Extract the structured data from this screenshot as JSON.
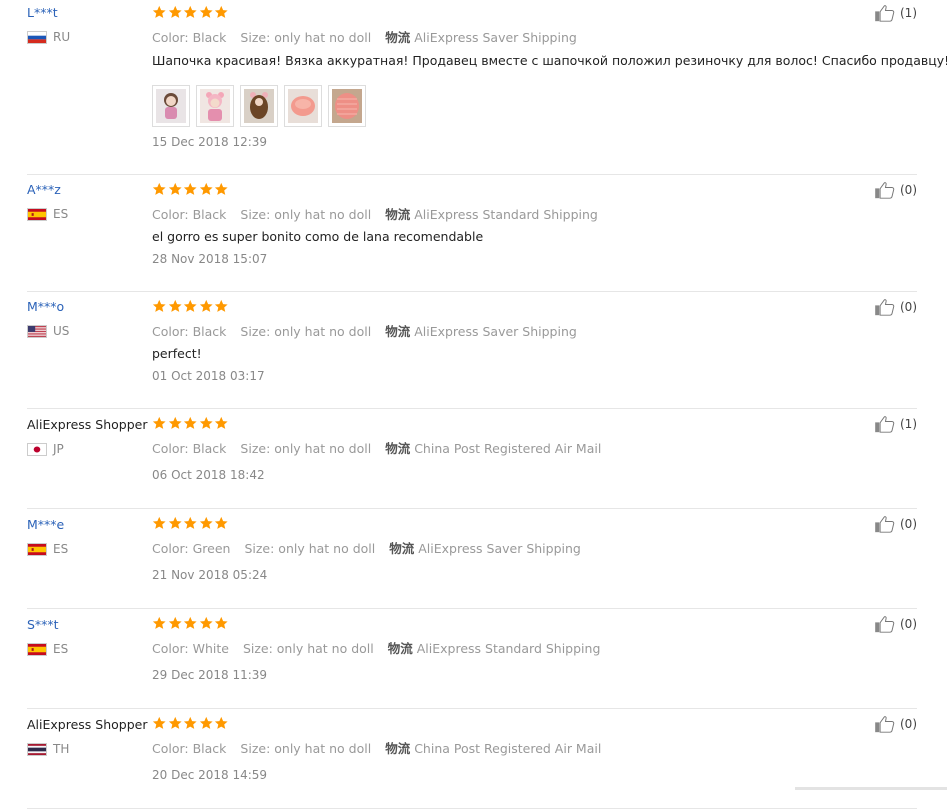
{
  "reviews": [
    {
      "user": "L***t",
      "country": "RU",
      "flag": "ru",
      "rating": 5,
      "color": "Color: Black",
      "size": "Size: only hat no doll",
      "ship_label": "物流",
      "shipping": "AliExpress Saver Shipping",
      "text": "Шапочка красивая! Вязка аккуратная! Продавец вместе с шапочкой положил резиночку для волос! Спасибо продавцу!",
      "photos": 5,
      "date": "15 Dec 2018 12:39",
      "useful": "(1)"
    },
    {
      "user": "A***z",
      "country": "ES",
      "flag": "es",
      "rating": 5,
      "color": "Color: Black",
      "size": "Size: only hat no doll",
      "ship_label": "物流",
      "shipping": "AliExpress Standard Shipping",
      "text": "el gorro es super bonito como de lana recomendable",
      "date": "28 Nov 2018 15:07",
      "useful": "(0)"
    },
    {
      "user": "M***o",
      "country": "US",
      "flag": "us",
      "rating": 5,
      "color": "Color: Black",
      "size": "Size: only hat no doll",
      "ship_label": "物流",
      "shipping": "AliExpress Saver Shipping",
      "text": "perfect!",
      "date": "01 Oct 2018 03:17",
      "useful": "(0)"
    },
    {
      "user": "AliExpress Shopper",
      "country": "JP",
      "flag": "jp",
      "rating": 5,
      "color": "Color: Black",
      "size": "Size: only hat no doll",
      "ship_label": "物流",
      "shipping": "China Post Registered Air Mail",
      "date": "06 Oct 2018 18:42",
      "useful": "(1)"
    },
    {
      "user": "M***e",
      "country": "ES",
      "flag": "es",
      "rating": 5,
      "color": "Color: Green",
      "size": "Size: only hat no doll",
      "ship_label": "物流",
      "shipping": "AliExpress Saver Shipping",
      "date": "21 Nov 2018 05:24",
      "useful": "(0)"
    },
    {
      "user": "S***t",
      "country": "ES",
      "flag": "es",
      "rating": 5,
      "color": "Color: White",
      "size": "Size: only hat no doll",
      "ship_label": "物流",
      "shipping": "AliExpress Standard Shipping",
      "date": "29 Dec 2018 11:39",
      "useful": "(0)"
    },
    {
      "user": "AliExpress Shopper",
      "country": "TH",
      "flag": "th",
      "rating": 5,
      "color": "Color: Black",
      "size": "Size: only hat no doll",
      "ship_label": "物流",
      "shipping": "China Post Registered Air Mail",
      "date": "20 Dec 2018 14:59",
      "useful": "(0)"
    }
  ],
  "colors": {
    "star": "#ff9900",
    "link": "#2b62b8"
  }
}
